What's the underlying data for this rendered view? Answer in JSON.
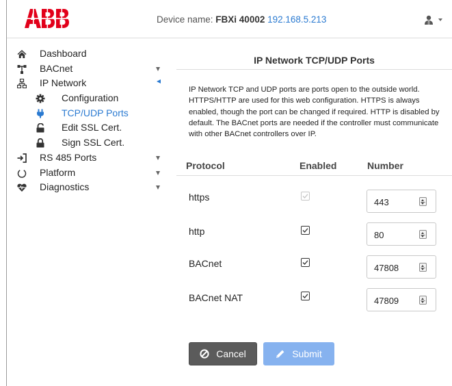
{
  "header": {
    "logo_text": "ABB",
    "device_prefix": "Device name: ",
    "device_name": "FBXi 40002",
    "device_ip": "192.168.5.213",
    "user_icon": "user-icon"
  },
  "sidebar": {
    "items": [
      {
        "label": "Dashboard",
        "icon": "home-icon"
      },
      {
        "label": "BACnet",
        "icon": "network-tree-icon"
      },
      {
        "label": "IP Network",
        "icon": "ip-network-icon"
      },
      {
        "label": "Configuration",
        "icon": "gear-icon"
      },
      {
        "label": "TCP/UDP Ports",
        "icon": "plug-icon"
      },
      {
        "label": "Edit SSL Cert.",
        "icon": "unlock-icon"
      },
      {
        "label": "Sign SSL Cert.",
        "icon": "lock-icon"
      },
      {
        "label": "RS 485 Ports",
        "icon": "sign-in-icon"
      },
      {
        "label": "Platform",
        "icon": "power-icon"
      },
      {
        "label": "Diagnostics",
        "icon": "heartbeat-icon"
      }
    ],
    "active_color": "#2a7ad1"
  },
  "panel": {
    "title": "IP Network TCP/UDP Ports",
    "description": "IP Network TCP and UDP ports are ports open to the outside world. HTTPS/HTTP are used for this web configuration. HTTPS is always enabled, though the port can be changed if required. HTTP is disabled by default. The BACnet ports are needed if the controller must communicate with other BACnet controllers over IP."
  },
  "table": {
    "headers": {
      "protocol": "Protocol",
      "enabled": "Enabled",
      "number": "Number"
    },
    "rows": [
      {
        "protocol": "https",
        "enabled": true,
        "disabled_checkbox": true,
        "number": "443"
      },
      {
        "protocol": "http",
        "enabled": true,
        "disabled_checkbox": false,
        "number": "80"
      },
      {
        "protocol": "BACnet",
        "enabled": true,
        "disabled_checkbox": false,
        "number": "47808"
      },
      {
        "protocol": "BACnet NAT",
        "enabled": true,
        "disabled_checkbox": false,
        "number": "47809"
      }
    ]
  },
  "buttons": {
    "cancel_label": "Cancel",
    "submit_label": "Submit",
    "cancel_icon": "ban-icon",
    "submit_icon": "pencil-icon"
  },
  "colors": {
    "brand_red": "#e2001a",
    "link_blue": "#2a7ad1",
    "cancel_bg": "#5b5b5b",
    "submit_bg": "#86b2ef"
  }
}
